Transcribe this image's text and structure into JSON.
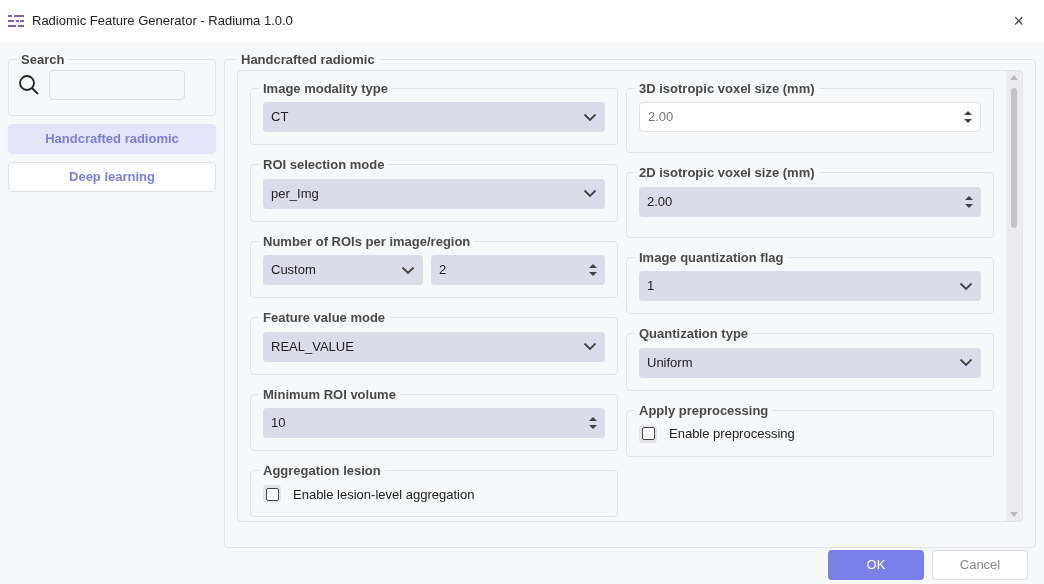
{
  "window": {
    "title": "Radiomic Feature Generator - Radiuma 1.0.0",
    "close": "×"
  },
  "sidebar": {
    "search": {
      "label": "Search"
    },
    "items": [
      {
        "label": "Handcrafted radiomic",
        "selected": true
      },
      {
        "label": "Deep learning",
        "selected": false
      }
    ]
  },
  "panel": {
    "title": "Handcrafted radiomic",
    "columns": [
      [
        {
          "kind": "combo",
          "label": "Image modality type",
          "value": "CT"
        },
        {
          "kind": "combo",
          "label": "ROI selection mode",
          "value": "per_Img"
        },
        {
          "kind": "combo_spin",
          "label": "Number of ROIs per image/region",
          "value": "Custom",
          "number": "2"
        },
        {
          "kind": "combo",
          "label": "Feature value mode",
          "value": "REAL_VALUE"
        },
        {
          "kind": "spin",
          "label": "Minimum ROI volume",
          "value": "10",
          "disabled": false
        },
        {
          "kind": "checkbox",
          "label": "Aggregation lesion",
          "text": "Enable lesion-level aggregation",
          "checked": false
        }
      ],
      [
        {
          "kind": "spin",
          "label": "3D isotropic voxel size (mm)",
          "value": "2.00",
          "disabled": true
        },
        {
          "kind": "spin",
          "label": "2D isotropic voxel size (mm)",
          "value": "2.00",
          "disabled": false
        },
        {
          "kind": "combo",
          "label": "Image quantization flag",
          "value": "1"
        },
        {
          "kind": "combo",
          "label": "Quantization type",
          "value": "Uniform"
        },
        {
          "kind": "checkbox",
          "label": "Apply preprocessing",
          "text": "Enable preprocessing",
          "checked": false
        }
      ]
    ]
  },
  "buttons": [
    {
      "label": "OK",
      "kind": "primary"
    },
    {
      "label": "Cancel",
      "kind": "secondary"
    }
  ]
}
